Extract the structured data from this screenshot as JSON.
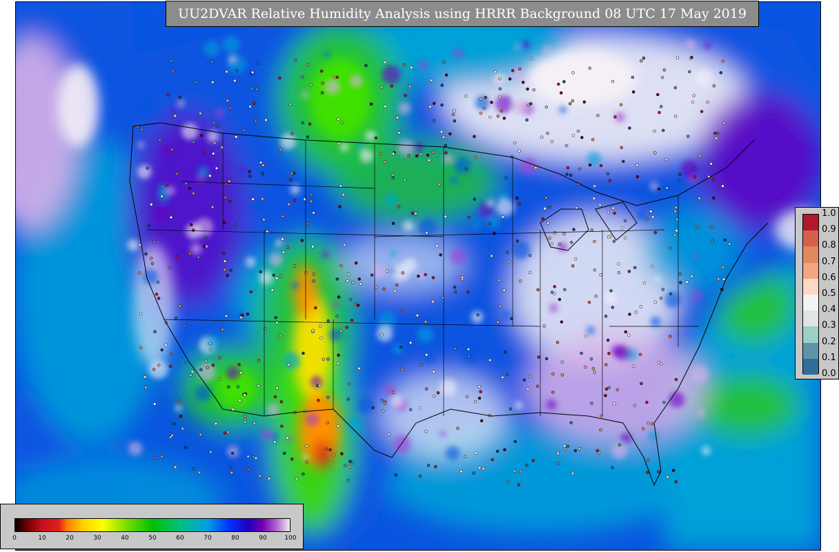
{
  "title": "UU2DVAR Relative Humidity Analysis using HRRR Background 08 UTC 17 May 2019",
  "station_legend": {
    "ticks": [
      "1.0",
      "0.9",
      "0.8",
      "0.7",
      "0.6",
      "0.5",
      "0.4",
      "0.3",
      "0.2",
      "0.1",
      "0.0"
    ],
    "colors": [
      "#67001f",
      "#b2182b",
      "#d6604d",
      "#e08a5c",
      "#f4a582",
      "#fcd9c4",
      "#f3f3f3",
      "#dfe5e5",
      "#9ccfc6",
      "#5e93a8",
      "#2e6e99",
      "#0c4a7a"
    ]
  },
  "rh_colorbar": {
    "ticks": [
      "0",
      "10",
      "20",
      "30",
      "40",
      "50",
      "60",
      "70",
      "80",
      "90",
      "100"
    ],
    "stops": [
      {
        "v": 0,
        "c": "#000000"
      },
      {
        "v": 4,
        "c": "#6b0000"
      },
      {
        "v": 10,
        "c": "#c8101c"
      },
      {
        "v": 16,
        "c": "#e02020"
      },
      {
        "v": 19,
        "c": "#ff7f00"
      },
      {
        "v": 25,
        "c": "#ffd400"
      },
      {
        "v": 32,
        "c": "#ffff00"
      },
      {
        "v": 40,
        "c": "#7fe000"
      },
      {
        "v": 50,
        "c": "#00c000"
      },
      {
        "v": 60,
        "c": "#00c080"
      },
      {
        "v": 70,
        "c": "#00a0e0"
      },
      {
        "v": 78,
        "c": "#0030ff"
      },
      {
        "v": 85,
        "c": "#2000c0"
      },
      {
        "v": 90,
        "c": "#7000b0"
      },
      {
        "v": 95,
        "c": "#b060d0"
      },
      {
        "v": 100,
        "c": "#f0f0f0"
      }
    ]
  },
  "map_colors": {
    "land_gray": "#c8c8c8",
    "ocean_blue": "#0a55e0",
    "ocean_cyan": "#00a0d8",
    "ocean_teal": "#00c0a0",
    "green": "#20c040",
    "bright_green": "#40e000",
    "yellow": "#f0e000",
    "orange": "#ff9000",
    "red": "#d02010",
    "purple": "#6a00c0",
    "magenta": "#a040d0",
    "lavender": "#d8b0e8",
    "white": "#f4f0f6",
    "border": "#000000"
  }
}
